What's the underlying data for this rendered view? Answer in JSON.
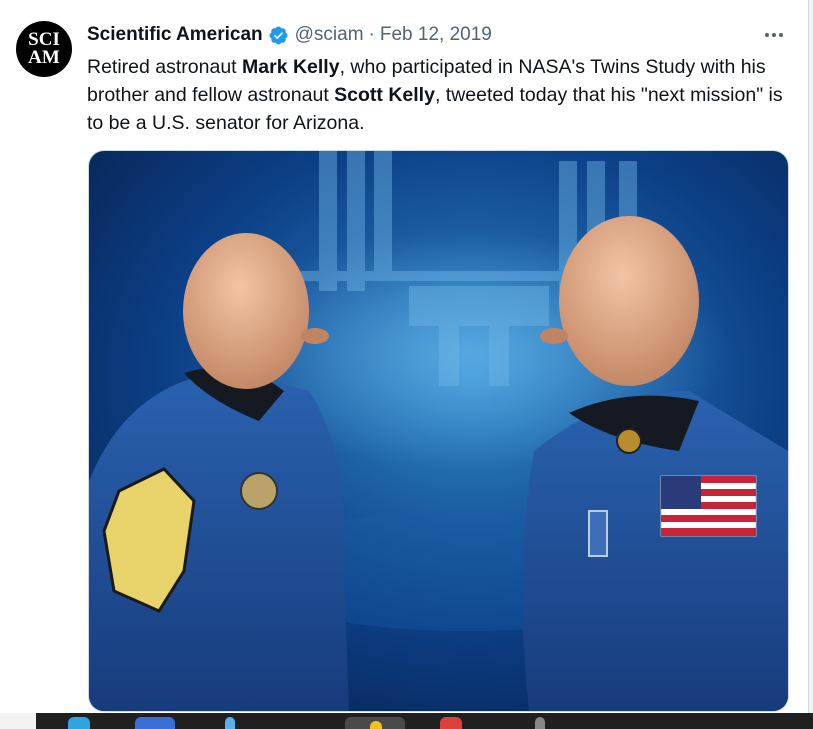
{
  "tweet": {
    "avatar": {
      "line1": "SCI",
      "line2": "AM"
    },
    "display_name": "Scientific American",
    "handle": "@sciam",
    "separator": "·",
    "date": "Feb 12, 2019",
    "more_icon": "more-horizontal-icon",
    "verified_icon": "verified-badge-icon",
    "text": {
      "p1": "Retired astronaut ",
      "b1": "Mark Kelly",
      "p2": ", who participated in NASA's Twins Study with his brother and fellow astronaut ",
      "b2": "Scott Kelly",
      "p3": ", tweeted today that his \"next mission\" is to be a U.S. senator for Arizona."
    }
  },
  "colors": {
    "text": "#0f1419",
    "secondary": "#536471",
    "verified": "#1d9bf0",
    "photo_background": "#0c3f86"
  }
}
